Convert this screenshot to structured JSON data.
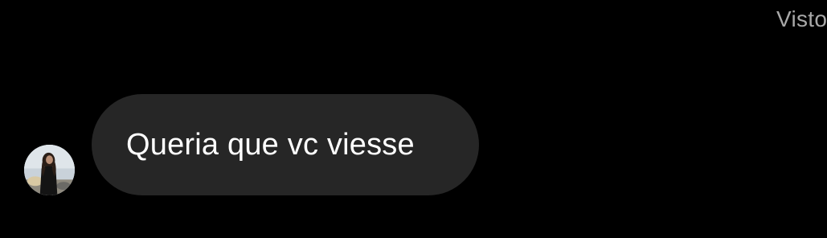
{
  "conversation": {
    "seen_status": "Visto",
    "messages": [
      {
        "sender": "contact",
        "text": "Queria que vc viesse",
        "avatar_icon": "contact-avatar"
      }
    ]
  },
  "colors": {
    "background": "#000000",
    "bubble_incoming": "#262626",
    "text_primary": "#ffffff",
    "text_secondary": "#a8a8a8"
  }
}
